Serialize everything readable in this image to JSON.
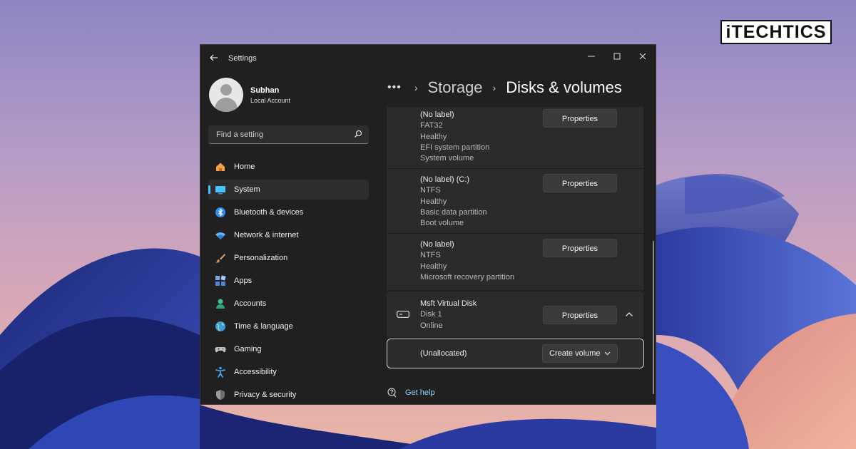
{
  "brand": {
    "logo_text": "iTECHTICS"
  },
  "window": {
    "title": "Settings",
    "back_icon": "back-arrow-icon",
    "controls": {
      "minimize": "—",
      "maximize": "□",
      "close": "✕"
    }
  },
  "user": {
    "name": "Subhan",
    "account_type": "Local Account"
  },
  "search": {
    "placeholder": "Find a setting",
    "value": ""
  },
  "nav": {
    "items": [
      {
        "label": "Home",
        "icon": "home-icon",
        "active": false
      },
      {
        "label": "System",
        "icon": "system-icon",
        "active": true
      },
      {
        "label": "Bluetooth & devices",
        "icon": "bluetooth-icon",
        "active": false
      },
      {
        "label": "Network & internet",
        "icon": "network-icon",
        "active": false
      },
      {
        "label": "Personalization",
        "icon": "brush-icon",
        "active": false
      },
      {
        "label": "Apps",
        "icon": "apps-icon",
        "active": false
      },
      {
        "label": "Accounts",
        "icon": "accounts-icon",
        "active": false
      },
      {
        "label": "Time & language",
        "icon": "globe-icon",
        "active": false
      },
      {
        "label": "Gaming",
        "icon": "gamepad-icon",
        "active": false
      },
      {
        "label": "Accessibility",
        "icon": "accessibility-icon",
        "active": false
      },
      {
        "label": "Privacy & security",
        "icon": "shield-icon",
        "active": false
      }
    ]
  },
  "breadcrumb": {
    "overflow": "•••",
    "sep": "›",
    "parent": "Storage",
    "current": "Disks & volumes"
  },
  "volumes": [
    {
      "lines": [
        "(No label)",
        "FAT32",
        "Healthy",
        "EFI system partition",
        "System volume"
      ],
      "button": "Properties"
    },
    {
      "lines": [
        "(No label) (C:)",
        "NTFS",
        "Healthy",
        "Basic data partition",
        "Boot volume"
      ],
      "button": "Properties"
    },
    {
      "lines": [
        "(No label)",
        "NTFS",
        "Healthy",
        "Microsoft recovery partition"
      ],
      "button": "Properties"
    }
  ],
  "disk": {
    "name": "Msft Virtual Disk",
    "number": "Disk 1",
    "status": "Online",
    "button": "Properties",
    "collapse_glyph": "˄"
  },
  "unallocated": {
    "label": "(Unallocated)",
    "button": "Create volume",
    "dropdown_glyph": "⌄"
  },
  "help": {
    "label": "Get help"
  },
  "colors": {
    "accent": "#4cc2ff",
    "window_bg": "#202020",
    "card_bg": "#2b2b2b",
    "link": "#8fd3ff"
  }
}
